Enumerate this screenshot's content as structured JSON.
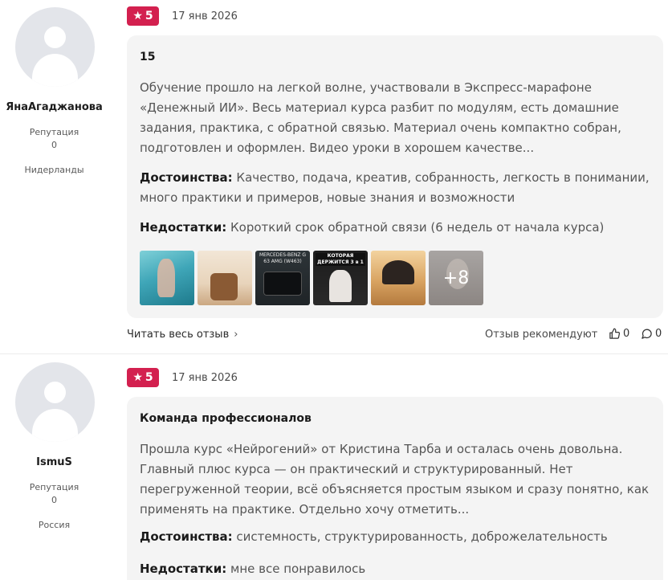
{
  "reviews": [
    {
      "author": {
        "name": "ЯнаАгаджанова",
        "reputation_label": "Репутация",
        "reputation_value": "0",
        "country": "Нидерланды"
      },
      "rating": "5",
      "date": "17 янв 2026",
      "title": "15",
      "text": "Обучение прошло на легкой волне, участвовали в Экспресс-марафоне «Денежный ИИ». Весь материал курса разбит по модулям, есть домашние задания, практика, с обратной связью. Материал очень компактно собран, подготовлен и оформлен. Видео уроки в хорошем качестве...",
      "pros_label": "Достоинства:",
      "pros": "Качество, подача, креатив, собранность, легкость в понимании, много практики и примеров, новые знания и возможности",
      "cons_label": "Недостатки:",
      "cons": "Короткий срок обратной связи (6 недель от начала курса)",
      "photos": {
        "thumb3_text": "MERCEDES-BENZ G 63 AMG (W463)",
        "thumb4_text": "КОТОРАЯ ДЕРЖИТСЯ 3 в 1",
        "more": "+8"
      },
      "read_more": "Читать весь отзыв",
      "recommend": "Отзыв рекомендуют",
      "likes": "0",
      "comments": "0"
    },
    {
      "author": {
        "name": "IsmuS",
        "reputation_label": "Репутация",
        "reputation_value": "0",
        "country": "Россия"
      },
      "rating": "5",
      "date": "17 янв 2026",
      "title": "Команда профессионалов",
      "text": "Прошла курс «Нейрогений» от Кристина Тарба и осталась очень довольна. Главный плюс курса — он практический и структурированный. Нет перегруженной теории, всё объясняется простым языком и сразу понятно, как применять на практике. Отдельно хочу отметить...",
      "pros_label": "Достоинства:",
      "pros": "системность, структурированность, доброжелательность",
      "cons_label": "Недостатки:",
      "cons": "мне все понравилось"
    }
  ],
  "icons": {
    "star": "star-icon",
    "chevron": "chevron-right-icon",
    "like": "thumbs-up-icon",
    "comment": "comment-icon"
  },
  "colors": {
    "rating_badge": "#d3204f",
    "card_background": "#f4f4f4"
  }
}
